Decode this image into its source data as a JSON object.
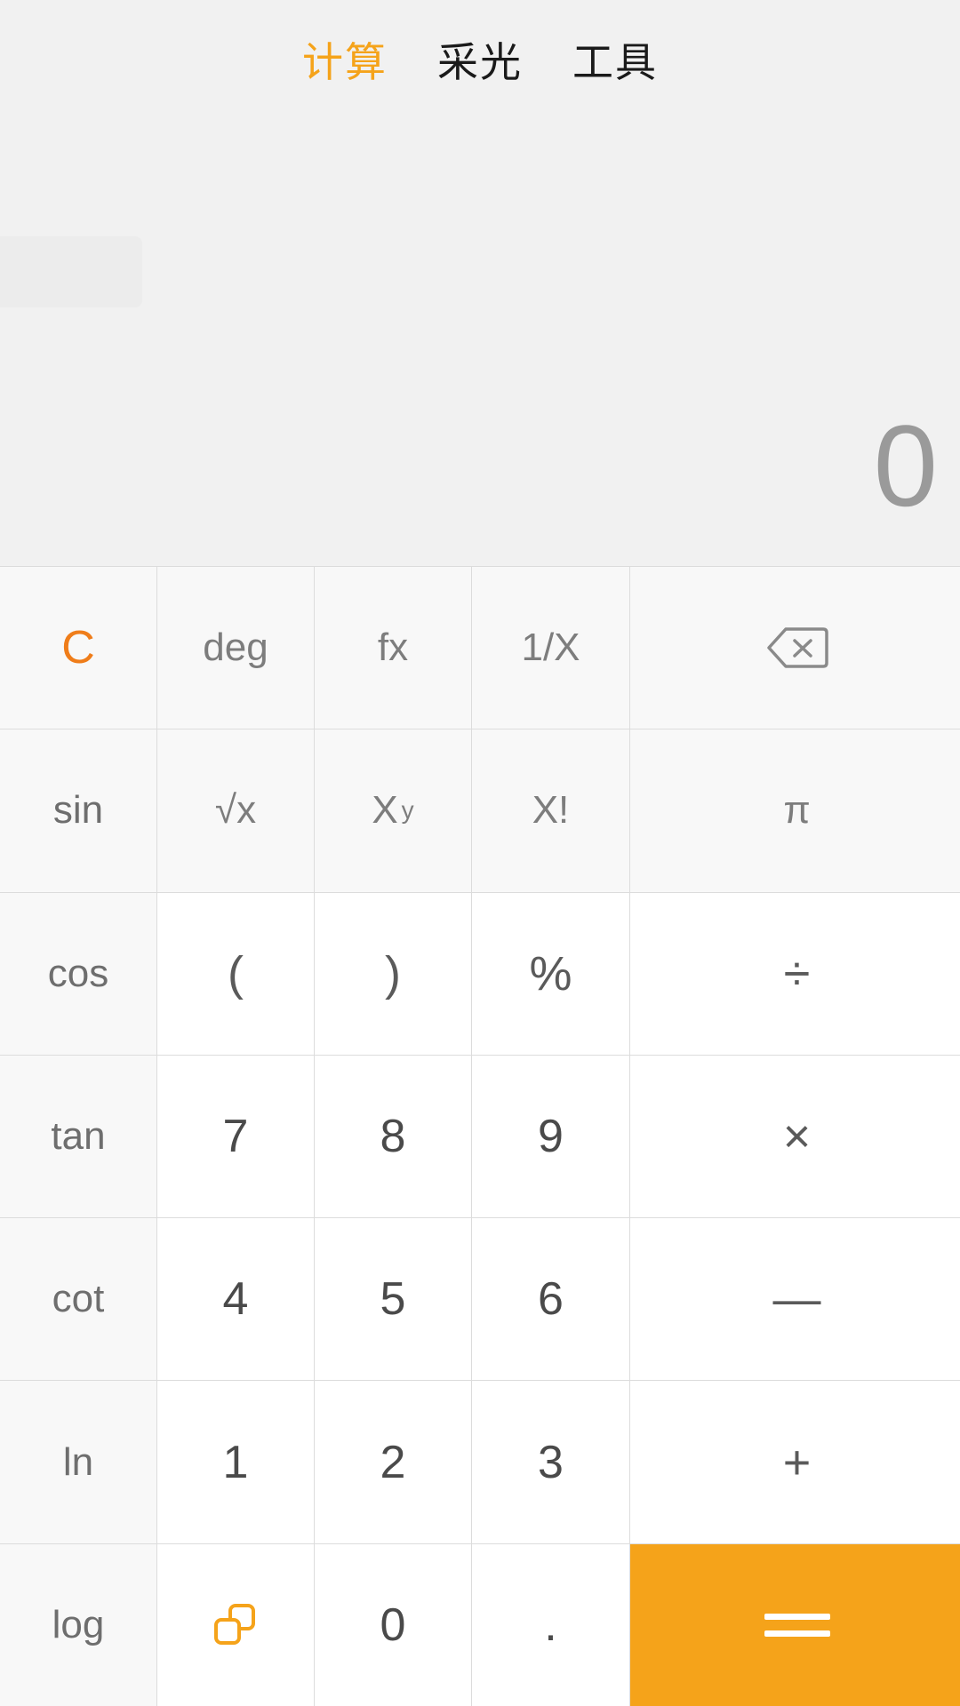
{
  "header": {
    "tabs": [
      {
        "label": "计算",
        "active": true
      },
      {
        "label": "采光",
        "active": false
      },
      {
        "label": "工具",
        "active": false
      }
    ]
  },
  "display": {
    "expression": "",
    "result": "0"
  },
  "colors": {
    "accent": "#f5a31a",
    "clear": "#ef7d1a",
    "keypad_bg": "#ffffff",
    "function_bg": "#f8f8f8",
    "screen_bg": "#f1f1f1",
    "text": "#5a5a5a"
  },
  "keypad": {
    "rows": [
      [
        {
          "label": "C",
          "name": "key-clear",
          "kind": "clear"
        },
        {
          "label": "deg",
          "name": "key-deg",
          "kind": "fn"
        },
        {
          "label": "fx",
          "name": "key-fx",
          "kind": "fn"
        },
        {
          "label": "1/X",
          "name": "key-reciprocal",
          "kind": "fn"
        },
        {
          "label": "",
          "name": "key-backspace",
          "kind": "fn-icon",
          "icon": "backspace-icon"
        }
      ],
      [
        {
          "label": "sin",
          "name": "key-sin",
          "kind": "sidecol"
        },
        {
          "label": "√x",
          "name": "key-sqrt",
          "kind": "fn-sqrt"
        },
        {
          "label": "X",
          "sup": "y",
          "name": "key-power",
          "kind": "fn-sup"
        },
        {
          "label": "X!",
          "name": "key-factorial",
          "kind": "fn"
        },
        {
          "label": "π",
          "name": "key-pi",
          "kind": "fn"
        }
      ],
      [
        {
          "label": "cos",
          "name": "key-cos",
          "kind": "sidecol"
        },
        {
          "label": "(",
          "name": "key-paren-open",
          "kind": "op"
        },
        {
          "label": ")",
          "name": "key-paren-close",
          "kind": "op"
        },
        {
          "label": "%",
          "name": "key-percent",
          "kind": "op"
        },
        {
          "label": "÷",
          "name": "key-divide",
          "kind": "op"
        }
      ],
      [
        {
          "label": "tan",
          "name": "key-tan",
          "kind": "sidecol"
        },
        {
          "label": "7",
          "name": "key-7",
          "kind": "num"
        },
        {
          "label": "8",
          "name": "key-8",
          "kind": "num"
        },
        {
          "label": "9",
          "name": "key-9",
          "kind": "num"
        },
        {
          "label": "×",
          "name": "key-multiply",
          "kind": "op"
        }
      ],
      [
        {
          "label": "cot",
          "name": "key-cot",
          "kind": "sidecol"
        },
        {
          "label": "4",
          "name": "key-4",
          "kind": "num"
        },
        {
          "label": "5",
          "name": "key-5",
          "kind": "num"
        },
        {
          "label": "6",
          "name": "key-6",
          "kind": "num"
        },
        {
          "label": "—",
          "name": "key-minus",
          "kind": "op"
        }
      ],
      [
        {
          "label": "ln",
          "name": "key-ln",
          "kind": "sidecol"
        },
        {
          "label": "1",
          "name": "key-1",
          "kind": "num"
        },
        {
          "label": "2",
          "name": "key-2",
          "kind": "num"
        },
        {
          "label": "3",
          "name": "key-3",
          "kind": "num"
        },
        {
          "label": "+",
          "name": "key-plus",
          "kind": "op"
        }
      ],
      [
        {
          "label": "log",
          "name": "key-log",
          "kind": "sidecol"
        },
        {
          "label": "",
          "name": "key-copy",
          "kind": "icon",
          "icon": "copy-icon"
        },
        {
          "label": "0",
          "name": "key-0",
          "kind": "num"
        },
        {
          "label": ".",
          "name": "key-decimal",
          "kind": "num"
        },
        {
          "label": "=",
          "name": "key-equals",
          "kind": "equals"
        }
      ]
    ]
  }
}
